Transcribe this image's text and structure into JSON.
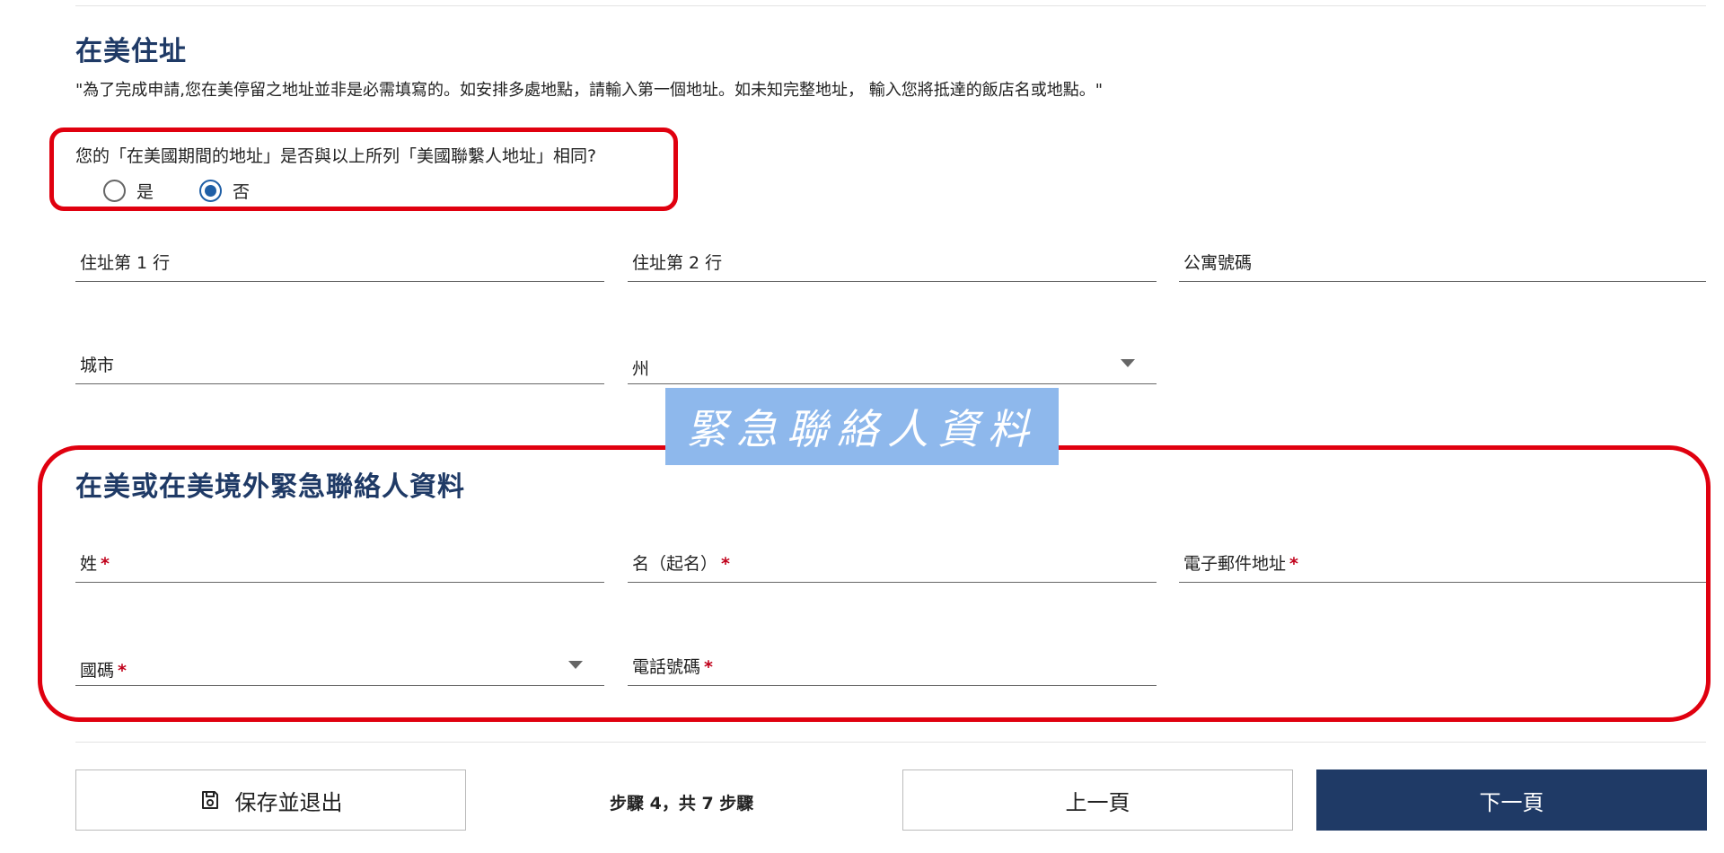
{
  "address_section": {
    "title": "在美住址",
    "intro": "\"為了完成申請,您在美停留之地址並非是必需填寫的。如安排多處地點，請輸入第一個地址。如未知完整地址， 輸入您將抵達的飯店名或地點。\"",
    "same_address_question": "您的「在美國期間的地址」是否與以上所列「美國聯繫人地址」相同?",
    "radio_options": [
      {
        "label": "是",
        "selected": false
      },
      {
        "label": "否",
        "selected": true
      }
    ],
    "fields": {
      "address_line1": {
        "label": "住址第 1 行",
        "value": ""
      },
      "address_line2": {
        "label": "住址第 2 行",
        "value": ""
      },
      "apartment": {
        "label": "公寓號碼",
        "value": ""
      },
      "city": {
        "label": "城市",
        "value": ""
      },
      "state": {
        "label": "州",
        "value": ""
      }
    }
  },
  "banner": {
    "text": "緊急聯絡人資料"
  },
  "emergency_section": {
    "title": "在美或在美境外緊急聯絡人資料",
    "required_mark": "*",
    "fields": {
      "last_name": {
        "label": "姓",
        "value": ""
      },
      "first_name": {
        "label": "名（起名）",
        "value": ""
      },
      "email": {
        "label": "電子郵件地址",
        "value": ""
      },
      "country_code": {
        "label": "國碼",
        "value": ""
      },
      "phone": {
        "label": "電話號碼",
        "value": ""
      }
    }
  },
  "footer": {
    "save_label": "保存並退出",
    "step_text": "步驟 4，共 7 步驟",
    "prev_label": "上一頁",
    "next_label": "下一頁"
  },
  "colors": {
    "title": "#1f3a66",
    "highlight": "#e0000f",
    "radio_selected": "#1f5fa6",
    "banner_bg": "#8eb8ec",
    "next_button": "#1f3a66",
    "required": "#c0001a"
  },
  "icons": {
    "save": "floppy-disk-icon",
    "dropdown": "chevron-down-icon"
  }
}
